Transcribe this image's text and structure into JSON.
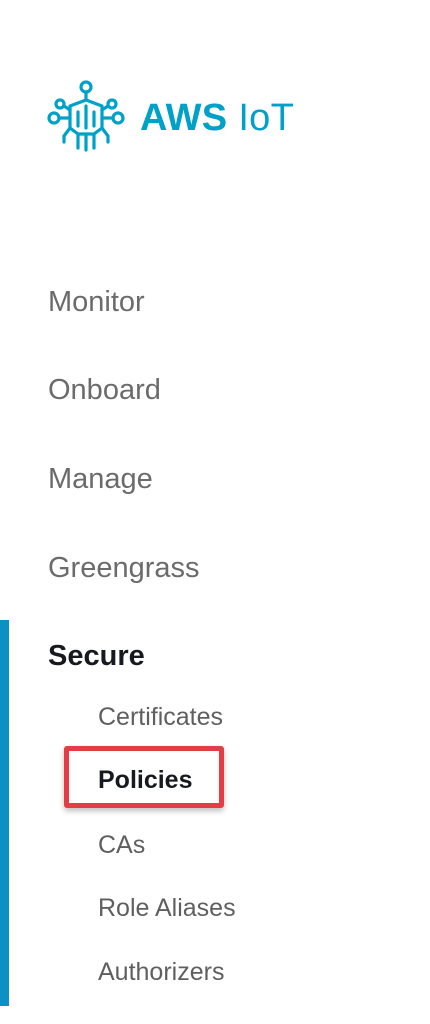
{
  "brand": {
    "name_bold": "AWS",
    "name_light": "IoT",
    "logo_icon": "aws-iot-circuit-icon",
    "color": "#00a1c9"
  },
  "nav": {
    "items": [
      {
        "label": "Monitor"
      },
      {
        "label": "Onboard"
      },
      {
        "label": "Manage"
      },
      {
        "label": "Greengrass"
      },
      {
        "label": "Secure",
        "active": true
      }
    ],
    "active_bar_color": "#0b91c4"
  },
  "secure_submenu": {
    "items": [
      {
        "label": "Certificates"
      },
      {
        "label": "Policies",
        "selected": true
      },
      {
        "label": "CAs"
      },
      {
        "label": "Role Aliases"
      },
      {
        "label": "Authorizers"
      }
    ]
  },
  "annotation": {
    "highlight_color": "#e43d45"
  }
}
